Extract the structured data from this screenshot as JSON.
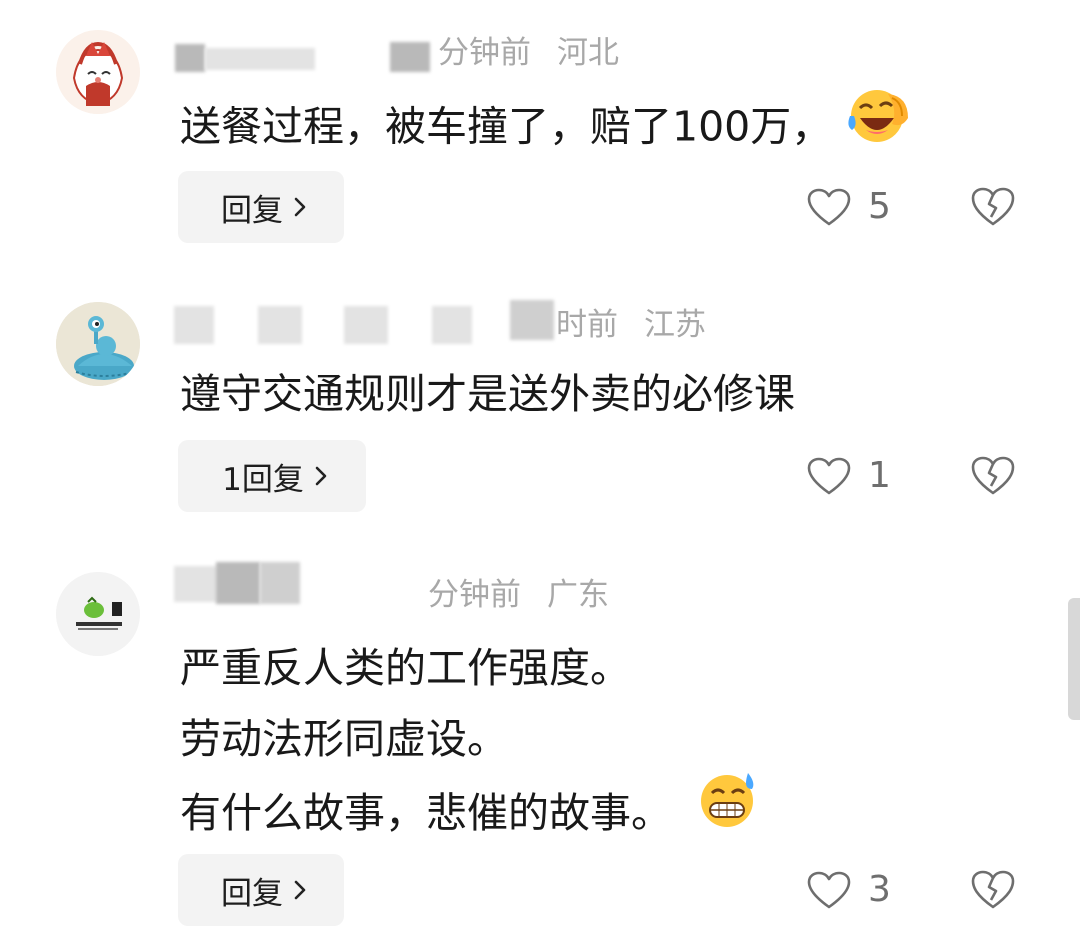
{
  "comments": [
    {
      "time": "分钟前",
      "location": "河北",
      "text_lines": [
        "送餐过程，被车撞了，赔了100万，"
      ],
      "emoji_icon": "face-with-tears-of-joy-icon",
      "reply_label": "回复",
      "likes": "5"
    },
    {
      "time": "时前",
      "location": "江苏",
      "text_lines": [
        "遵守交通规则才是送外卖的必修课"
      ],
      "reply_label": "1回复",
      "likes": "1"
    },
    {
      "time": "分钟前",
      "location": "广东",
      "text_lines": [
        "严重反人类的工作强度。",
        "劳动法形同虚设。",
        "有什么故事，悲催的故事。"
      ],
      "emoji_icon": "grinning-face-with-sweat-icon",
      "reply_label": "回复",
      "likes": "3"
    }
  ],
  "icons": {
    "like": "heart-outline-icon",
    "dislike": "broken-heart-icon",
    "reply_arrow": "chevron-right-icon"
  },
  "colors": {
    "meta_text": "#a8a8a8",
    "reply_bg": "#f3f3f3",
    "emoji_yellow": "#ffc83d"
  }
}
